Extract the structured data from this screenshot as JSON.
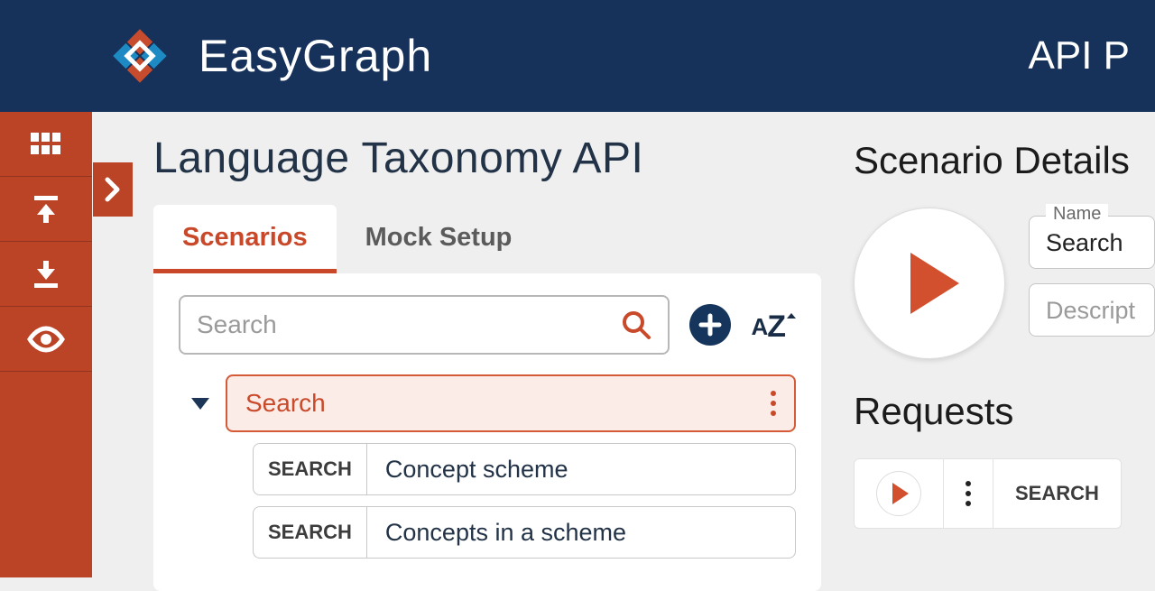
{
  "brand": {
    "name": "EasyGraph"
  },
  "header": {
    "right_text": "API P"
  },
  "page": {
    "title": "Language Taxonomy API"
  },
  "tabs": [
    {
      "label": "Scenarios",
      "active": true
    },
    {
      "label": "Mock Setup",
      "active": false
    }
  ],
  "search": {
    "placeholder": "Search"
  },
  "sort_label": "AZ",
  "tree": {
    "selected": {
      "label": "Search"
    },
    "children": [
      {
        "badge": "SEARCH",
        "label": "Concept scheme"
      },
      {
        "badge": "SEARCH",
        "label": "Concepts in a scheme"
      }
    ]
  },
  "details": {
    "title": "Scenario Details",
    "name_label": "Name",
    "name_value": "Search",
    "description_placeholder": "Descript"
  },
  "requests": {
    "title": "Requests",
    "badge": "SEARCH"
  }
}
